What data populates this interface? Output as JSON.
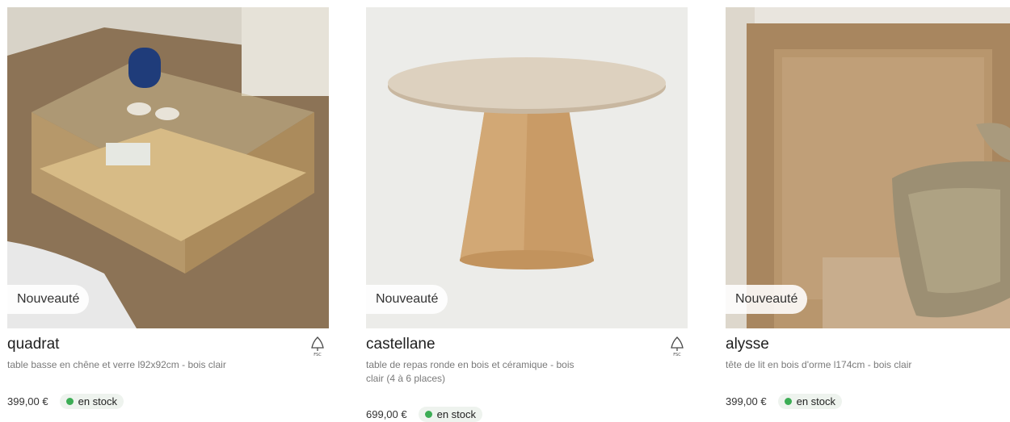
{
  "products": [
    {
      "badge": "Nouveauté",
      "name": "quadrat",
      "description": "table basse en chêne et verre l92x92cm - bois clair",
      "price": "399,00 €",
      "stock": "en stock",
      "fsc": true
    },
    {
      "badge": "Nouveauté",
      "name": "castellane",
      "description": "table de repas ronde en bois et céramique - bois clair (4 à 6 places)",
      "price": "699,00 €",
      "stock": "en stock",
      "fsc": true
    },
    {
      "badge": "Nouveauté",
      "name": "alysse",
      "description": "tête de lit en bois d'orme l174cm - bois clair",
      "price": "399,00 €",
      "stock": "en stock",
      "fsc": false
    }
  ],
  "colors": {
    "stock_dot": "#3cad55",
    "badge_bg": "#ffffff"
  },
  "icons": {
    "fsc": "fsc-tree-icon"
  }
}
